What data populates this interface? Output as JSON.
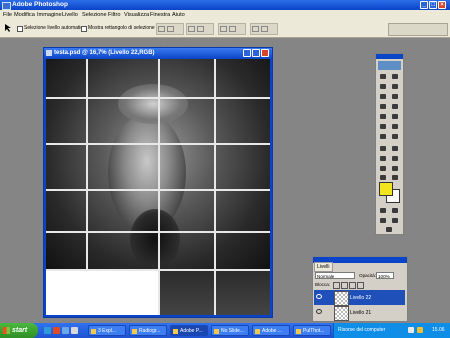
{
  "app": {
    "title": "Adobe Photoshop",
    "window_buttons": {
      "minimize": "_",
      "maximize": "□",
      "close": "×"
    }
  },
  "menu": [
    "File",
    "Modifica",
    "Immagine",
    "Livello",
    "Selezione",
    "Filtro",
    "Visualizza",
    "Finestra",
    "Aiuto"
  ],
  "options_bar": {
    "auto_select_label": "Selezione livello automatica",
    "show_bounds_label": "Mostra rettangolo di selezione"
  },
  "document": {
    "title": "testa.psd @ 16,7% (Livello 22,RGB)"
  },
  "layers_palette": {
    "tab_label": "Livelli",
    "blend_mode": "Normale",
    "opacity_label": "Opacità:",
    "opacity_value": "100%",
    "lock_label": "Blocca:",
    "layers": [
      {
        "name": "Livello 22",
        "selected": true
      },
      {
        "name": "Livello 21",
        "selected": false
      }
    ]
  },
  "taskbar": {
    "start_label": "start",
    "tasks": [
      {
        "label": "3 Expl..."
      },
      {
        "label": "Radiogr..."
      },
      {
        "label": "Adobe P..."
      },
      {
        "label": "No Slide..."
      },
      {
        "label": "Adobe ..."
      },
      {
        "label": "PulThot..."
      }
    ],
    "tray_text": "Risorse del computer",
    "clock": "15.06"
  },
  "colors": {
    "foreground": "#f2e51d",
    "background": "#ffffff",
    "title_blue": "#0a44c8",
    "taskbar_blue": "#2f72f0"
  }
}
